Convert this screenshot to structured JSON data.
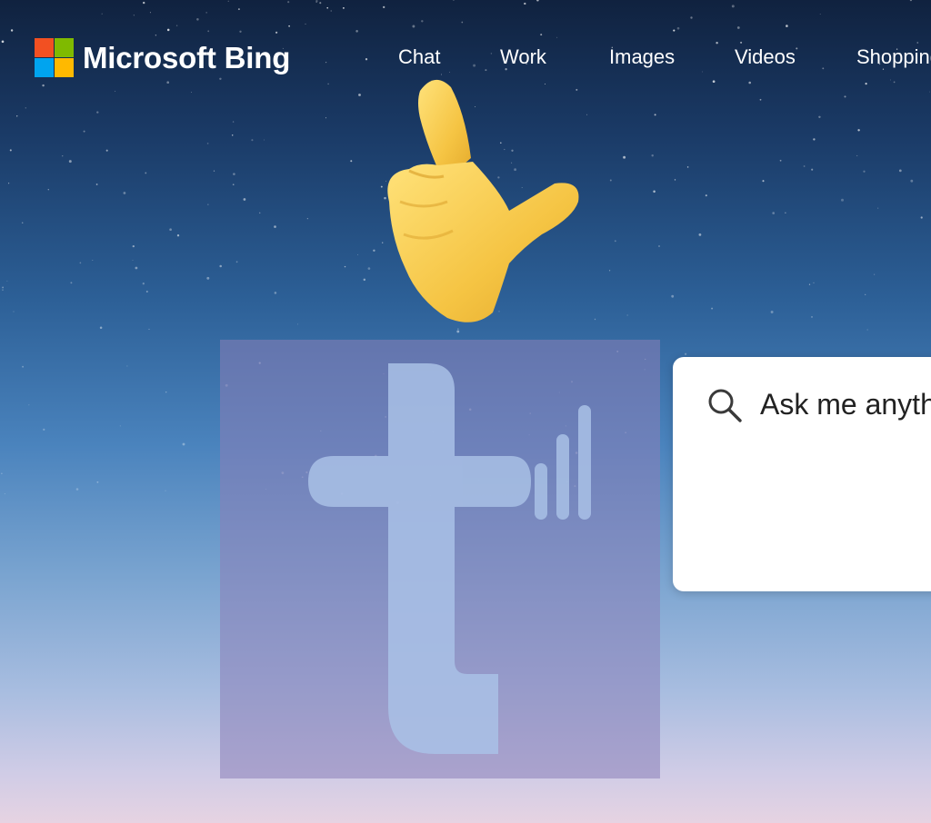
{
  "brand": {
    "name": "Microsoft Bing",
    "logo_colors": [
      "#f25022",
      "#7fba00",
      "#00a4ef",
      "#ffb900"
    ]
  },
  "nav": {
    "items": [
      {
        "label": "Chat"
      },
      {
        "label": "Work"
      },
      {
        "label": "Images"
      },
      {
        "label": "Videos"
      },
      {
        "label": "Shopping"
      }
    ]
  },
  "search": {
    "placeholder": "Ask me anything",
    "icon": "search-icon"
  },
  "overlay": {
    "emoji_icon": "backhand-index-pointing-up-icon",
    "watermark_icon": "t-signal-watermark-icon"
  },
  "colors": {
    "sky_top": "#10223f",
    "sky_bottom": "#e6d3e2",
    "watermark": "#8a7fb8",
    "emoji": "#f7c847"
  }
}
